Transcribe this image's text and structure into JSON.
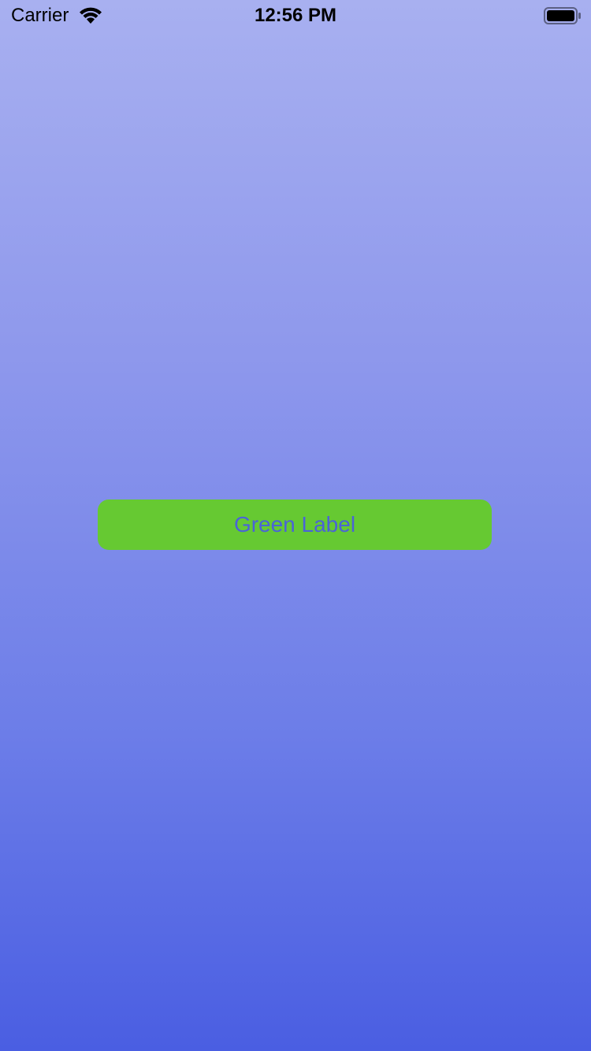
{
  "status_bar": {
    "carrier": "Carrier",
    "time": "12:56 PM",
    "wifi_icon": "wifi-icon",
    "battery_icon": "battery-icon"
  },
  "main": {
    "label_text": "Green Label",
    "label_background": "#66c932",
    "label_text_color": "#4a63d8"
  },
  "colors": {
    "gradient_top": "#a8b0f0",
    "gradient_bottom": "#4a5ee2"
  }
}
